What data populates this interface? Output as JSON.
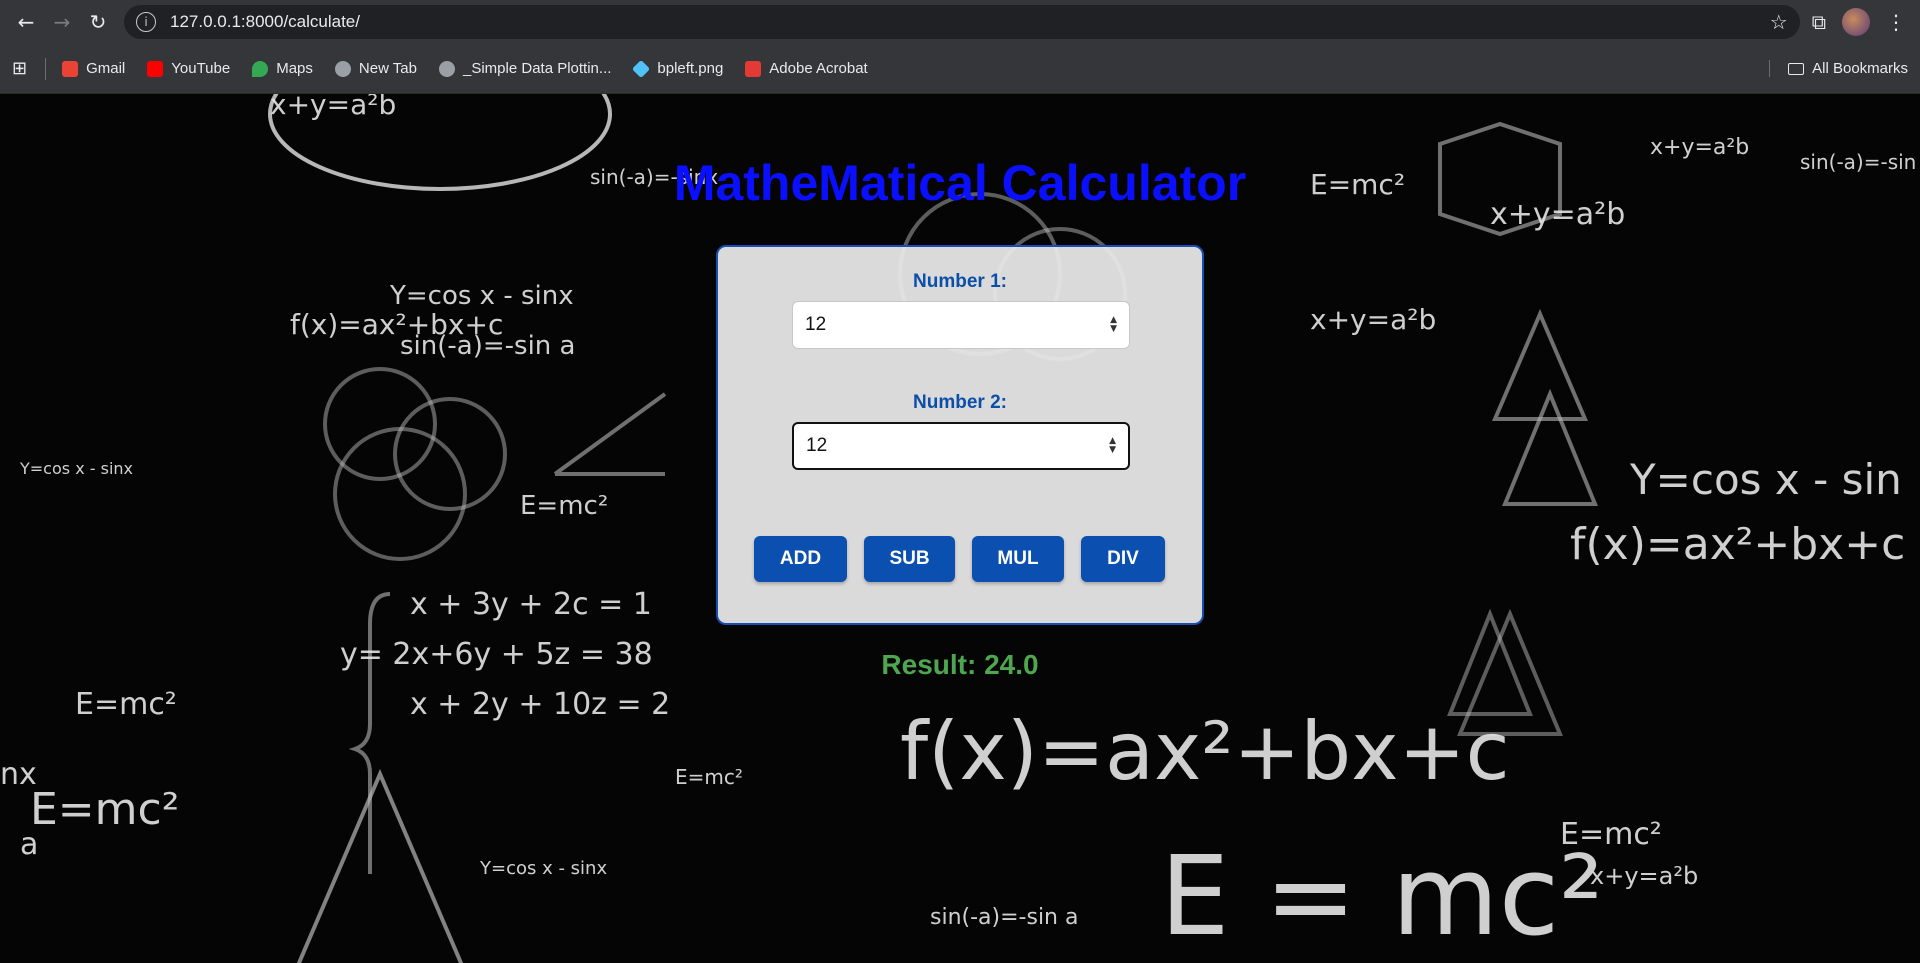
{
  "browser": {
    "url": "127.0.0.1:8000/calculate/",
    "icons": {
      "back": "arrow-left-icon",
      "forward": "arrow-right-icon",
      "reload": "reload-icon",
      "info": "info-icon",
      "star": "star-icon",
      "extensions": "puzzle-icon",
      "menu": "kebab-menu-icon"
    }
  },
  "bookmarks": {
    "items": [
      {
        "label": "Gmail",
        "color": "#ea4335"
      },
      {
        "label": "YouTube",
        "color": "#ff0000"
      },
      {
        "label": "Maps",
        "color": "#34a853"
      },
      {
        "label": "New Tab",
        "color": "#9aa0a6"
      },
      {
        "label": "_Simple Data Plottin...",
        "color": "#9aa0a6"
      },
      {
        "label": "bpleft.png",
        "color": "#4fc3f7"
      },
      {
        "label": "Adobe Acrobat",
        "color": "#e53935"
      }
    ],
    "all_label": "All Bookmarks"
  },
  "page": {
    "title": "MatheMatical Calculator",
    "number1_label": "Number 1:",
    "number1_value": "12",
    "number2_label": "Number 2:",
    "number2_value": "12",
    "buttons": {
      "add": "ADD",
      "sub": "SUB",
      "mul": "MUL",
      "div": "DIV"
    },
    "result": "Result: 24.0",
    "colors": {
      "title": "#0a10ff",
      "label": "#0b4fa8",
      "button": "#0b4fb0",
      "result": "#4ea64f"
    }
  }
}
